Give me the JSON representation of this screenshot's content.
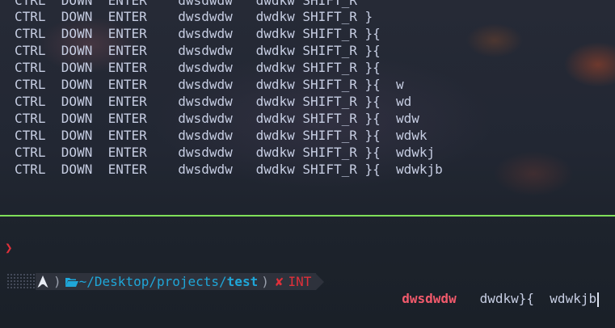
{
  "terminal": {
    "output_lines": [
      "CTRL  DOWN  ENTER    dwsdwdw   dwdkw SHIFT_R",
      "CTRL  DOWN  ENTER    dwsdwdw   dwdkw SHIFT_R }",
      "CTRL  DOWN  ENTER    dwsdwdw   dwdkw SHIFT_R }{",
      "CTRL  DOWN  ENTER    dwsdwdw   dwdkw SHIFT_R }{",
      "CTRL  DOWN  ENTER    dwsdwdw   dwdkw SHIFT_R }{",
      "CTRL  DOWN  ENTER    dwsdwdw   dwdkw SHIFT_R }{  w",
      "CTRL  DOWN  ENTER    dwsdwdw   dwdkw SHIFT_R }{  wd",
      "CTRL  DOWN  ENTER    dwsdwdw   dwdkw SHIFT_R }{  wdw",
      "CTRL  DOWN  ENTER    dwsdwdw   dwdkw SHIFT_R }{  wdwk",
      "CTRL  DOWN  ENTER    dwsdwdw   dwdkw SHIFT_R }{  wdwkj",
      "CTRL  DOWN  ENTER    dwsdwdw   dwdkw SHIFT_R }{  wdwkjb"
    ],
    "prompt_char": "❯"
  },
  "prompt": {
    "os_icon": "arch-linux-icon",
    "separator": ")",
    "folder_icon": "folder-open-icon",
    "path_prefix": "~/Desktop/projects/",
    "path_current": "test",
    "separator_2": ")",
    "status_icon": "✘",
    "status_text": "INT"
  },
  "input": {
    "command": "dwsdwdw",
    "args": "   dwdkw}{  wdwkjb"
  },
  "colors": {
    "divider": "#7fe05a",
    "error": "#e0303a",
    "path": "#1fa6d8",
    "command": "#f25a6c",
    "text": "#c6cde2"
  }
}
